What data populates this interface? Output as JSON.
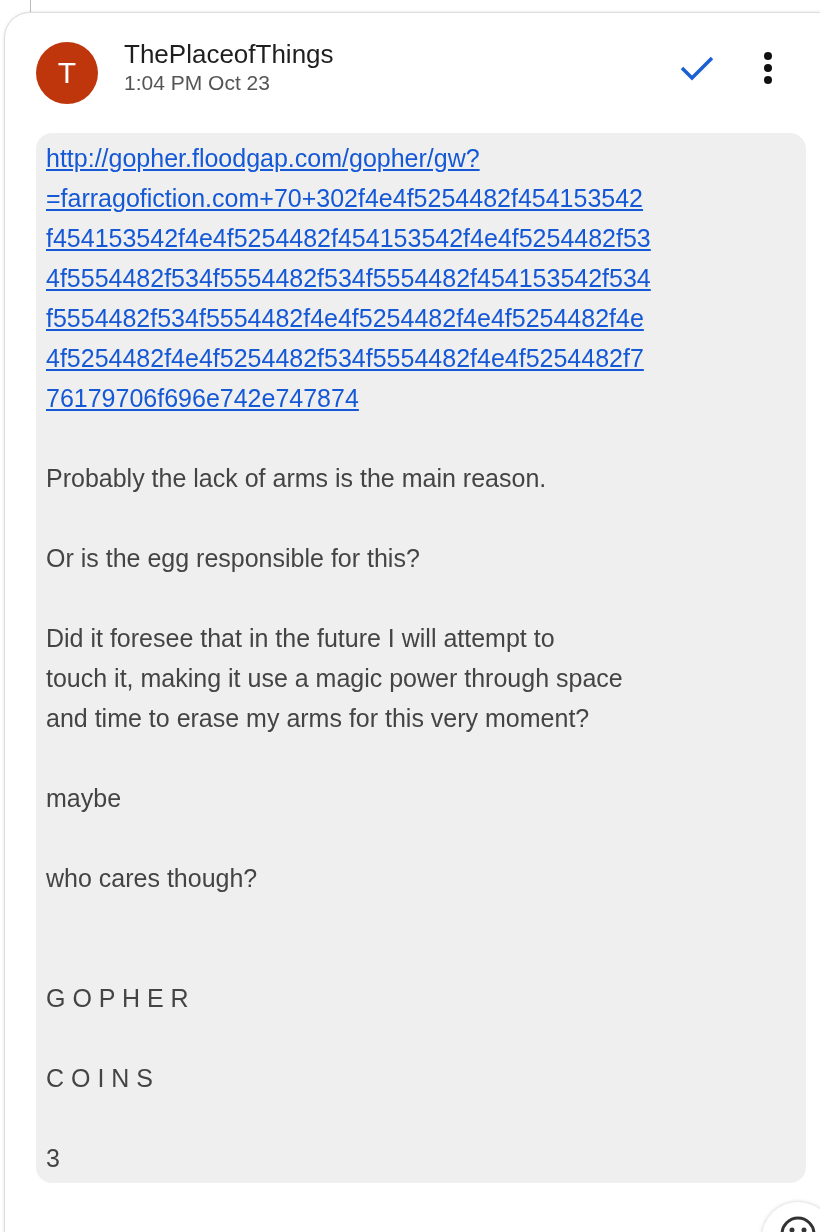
{
  "message": {
    "avatar_letter": "T",
    "author": "ThePlaceofThings",
    "time": "1:04 PM Oct 23",
    "read": true,
    "link_lines": [
      "http://gopher.floodgap.com/gopher/gw?",
      "=farragofiction.com+70+302f4e4f5254482f454153542",
      "f454153542f4e4f5254482f454153542f4e4f5254482f53",
      "4f5554482f534f5554482f534f5554482f454153542f534",
      "f5554482f534f5554482f4e4f5254482f4e4f5254482f4e",
      "4f5254482f4e4f5254482f534f5554482f4e4f5254482f7",
      "76179706f696e742e747874"
    ],
    "paragraphs": [
      {
        "lines": [
          "Probably the lack of arms is the main reason."
        ]
      },
      {
        "lines": [
          "Or is the egg responsible for this?"
        ]
      },
      {
        "lines": [
          "Did it foresee that in the future I will attempt to",
          "touch it, making it use a magic power through space",
          "and time to erase my arms for this very moment?"
        ]
      },
      {
        "lines": [
          "maybe"
        ]
      },
      {
        "lines": [
          "who cares though?"
        ]
      }
    ],
    "signature": [
      "G O P H E R",
      "C O I N S",
      "3"
    ]
  }
}
